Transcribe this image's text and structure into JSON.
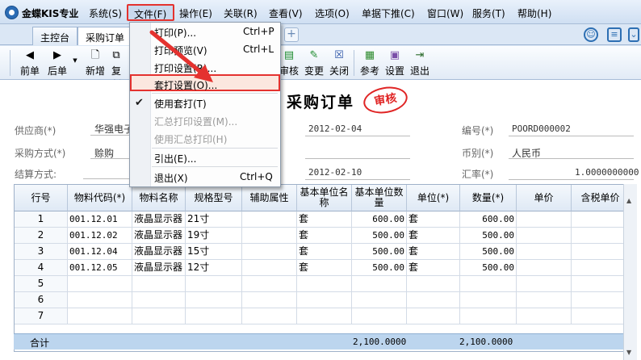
{
  "app": {
    "name": "金蝶KIS专业"
  },
  "menubar": [
    "系统(S)",
    "文件(F)",
    "操作(E)",
    "关联(R)",
    "查看(V)",
    "选项(O)",
    "单据下推(C)",
    "窗口(W)",
    "服务(T)",
    "帮助(H)"
  ],
  "tabs": [
    "主控台",
    "采购订单"
  ],
  "toolbar": [
    "前单",
    "后单",
    "新增",
    "复制",
    "审核",
    "变更",
    "关闭",
    "参考",
    "设置",
    "退出"
  ],
  "file_menu": {
    "print": "打印(P)...",
    "print_sc": "Ctrl+P",
    "preview": "打印预览(V)",
    "preview_sc": "Ctrl+L",
    "print_setup": "打印设置(R)...",
    "template_setup": "套打设置(O)...",
    "use_template": "使用套打(T)",
    "summary_setup": "汇总打印设置(M)...",
    "use_summary": "使用汇总打印(H)",
    "export": "引出(E)...",
    "exit": "退出(X)",
    "exit_sc": "Ctrl+Q"
  },
  "document": {
    "title": "采购订单",
    "stamp": "审核",
    "supplier_label": "供应商(*)",
    "supplier_value": "华强电子",
    "purchase_method_label": "采购方式(*)",
    "purchase_method_value": "赊购",
    "settlement_label": "结算方式:",
    "date1": "2012-02-04",
    "date2": "2012-02-10",
    "number_label": "编号(*)",
    "number_value": "POORD000002",
    "currency_label": "币别(*)",
    "currency_value": "人民币",
    "rate_label": "汇率(*)",
    "rate_value": "1.0000000000"
  },
  "grid": {
    "headers": [
      "行号",
      "物料代码(*)",
      "物料名称",
      "规格型号",
      "辅助属性",
      "基本单位名称",
      "基本单位数量",
      "单位(*)",
      "数量(*)",
      "单价",
      "含税单价"
    ],
    "rows": [
      [
        "1",
        "001.12.01",
        "液晶显示器",
        "21寸",
        "",
        "套",
        "600.00",
        "套",
        "600.00",
        "",
        ""
      ],
      [
        "2",
        "001.12.02",
        "液晶显示器",
        "19寸",
        "",
        "套",
        "500.00",
        "套",
        "500.00",
        "",
        ""
      ],
      [
        "3",
        "001.12.04",
        "液晶显示器",
        "15寸",
        "",
        "套",
        "500.00",
        "套",
        "500.00",
        "",
        ""
      ],
      [
        "4",
        "001.12.05",
        "液晶显示器",
        "12寸",
        "",
        "套",
        "500.00",
        "套",
        "500.00",
        "",
        ""
      ],
      [
        "5",
        "",
        "",
        "",
        "",
        "",
        "",
        "",
        "",
        "",
        ""
      ],
      [
        "6",
        "",
        "",
        "",
        "",
        "",
        "",
        "",
        "",
        "",
        ""
      ],
      [
        "7",
        "",
        "",
        "",
        "",
        "",
        "",
        "",
        "",
        "",
        ""
      ]
    ],
    "total_label": "合计",
    "total_base_qty": "2,100.0000",
    "total_qty": "2,100.0000"
  }
}
